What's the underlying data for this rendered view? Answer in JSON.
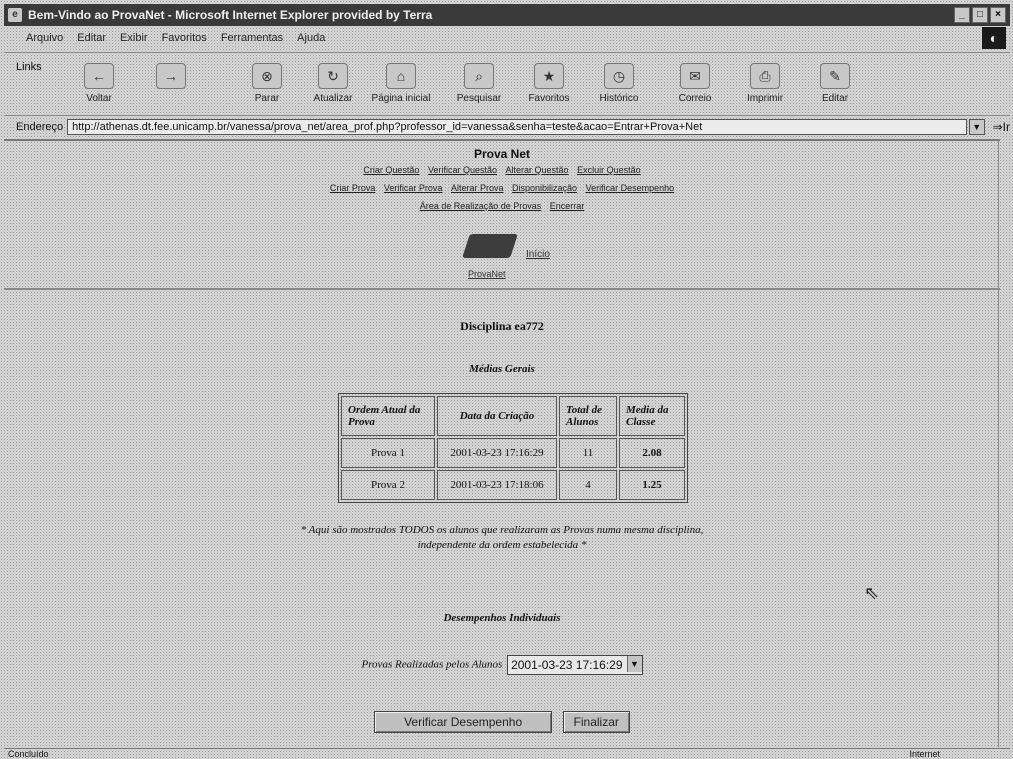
{
  "window": {
    "title": "Bem-Vindo ao ProvaNet - Microsoft Internet Explorer provided by Terra",
    "buttons": [
      "_",
      "□",
      "×"
    ]
  },
  "menu": [
    "Arquivo",
    "Editar",
    "Exibir",
    "Favoritos",
    "Ferramentas",
    "Ajuda"
  ],
  "toolbar": {
    "links_label": "Links",
    "buttons": [
      "Voltar",
      "→",
      "Parar",
      "Atualizar",
      "Página inicial",
      "Pesquisar",
      "Favoritos",
      "Histórico",
      "Correio",
      "Imprimir",
      "Editar"
    ]
  },
  "address": {
    "label": "Endereço",
    "url": "http://athenas.dt.fee.unicamp.br/vanessa/prova_net/area_prof.php?professor_id=vanessa&senha=teste&acao=Entrar+Prova+Net",
    "go_label": "Ir"
  },
  "nav": {
    "title": "Prova Net",
    "row1": [
      "Criar Questão",
      "Verificar Questão",
      "Alterar Questão",
      "Excluir Questão"
    ],
    "row2": [
      "Criar Prova",
      "Verificar Prova",
      "Alterar Prova",
      "Disponibilização",
      "Verificar Desempenho"
    ],
    "row3": [
      "Área de Realização de Provas",
      "Encerrar"
    ],
    "logo_link": "Início",
    "logo_caption": "ProvaNet"
  },
  "content": {
    "discipline_title": "Disciplina ea772",
    "medias_title": "Médias Gerais",
    "table": {
      "headers": [
        "Ordem Atual da Prova",
        "Data da Criação",
        "Total de Alunos",
        "Media da Classe"
      ],
      "rows": [
        [
          "Prova 1",
          "2001-03-23 17:16:29",
          "11",
          "2.08"
        ],
        [
          "Prova 2",
          "2001-03-23 17:18:06",
          "4",
          "1.25"
        ]
      ]
    },
    "note_line1": "* Aqui são mostrados TODOS os alunos que realizaram as Provas numa mesma disciplina,",
    "note_line2": "independente da ordem estabelecida *",
    "desempenhos_title": "Desempenhos Individuais",
    "provas_label": "Provas Realizadas pelos Alunos",
    "provas_selected": "2001-03-23 17:16:29",
    "verify_button": "Verificar Desempenho",
    "finish_button": "Finalizar"
  },
  "status": {
    "left": "Concluído",
    "right": "Internet"
  }
}
